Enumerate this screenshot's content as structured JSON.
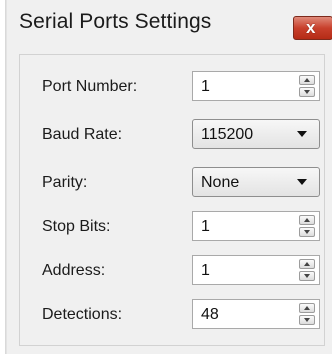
{
  "window": {
    "title": "Serial Ports Settings",
    "close_symbol": "x"
  },
  "fields": [
    {
      "label": "Port Number:",
      "value": "1",
      "control": "spinbox"
    },
    {
      "label": "Baud Rate:",
      "value": "115200",
      "control": "dropdown"
    },
    {
      "label": "Parity:",
      "value": "None",
      "control": "dropdown"
    },
    {
      "label": "Stop Bits:",
      "value": "1",
      "control": "spinbox"
    },
    {
      "label": "Address:",
      "value": "1",
      "control": "spinbox"
    },
    {
      "label": "Detections:",
      "value": "48",
      "control": "spinbox"
    }
  ],
  "colors": {
    "window_bg": "#f0f0f0",
    "close_button": "#c8402c",
    "text": "#1b1b1b"
  }
}
